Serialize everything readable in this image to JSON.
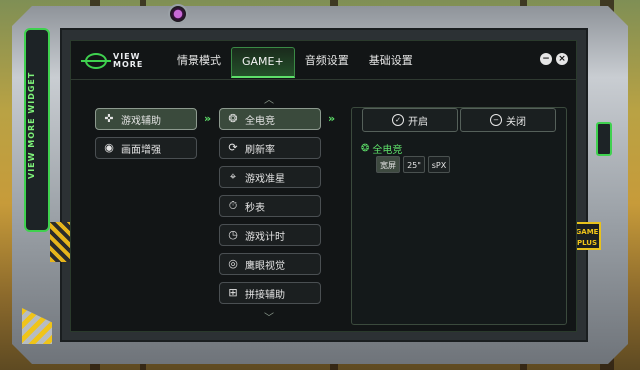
{
  "app": {
    "logo_line1": "VIEW",
    "logo_line2": "MORE",
    "side_label": "VIEW MORE WIDGET",
    "badge_line1": "GAME",
    "badge_line2": "PLUS"
  },
  "nav": {
    "tabs": [
      {
        "label": "情景模式",
        "active": false
      },
      {
        "label": "GAME+",
        "active": true
      },
      {
        "label": "音频设置",
        "active": false
      },
      {
        "label": "基础设置",
        "active": false
      }
    ],
    "minimize_label": "−",
    "close_label": "×"
  },
  "left_menu": [
    {
      "label": "游戏辅助",
      "icon": "gamepad-icon",
      "selected": true
    },
    {
      "label": "画面增强",
      "icon": "camera-lens-icon",
      "selected": false
    }
  ],
  "middle_menu": [
    {
      "label": "全电竞",
      "icon": "esports-icon",
      "selected": true
    },
    {
      "label": "刷新率",
      "icon": "refresh-icon",
      "selected": false
    },
    {
      "label": "游戏准星",
      "icon": "crosshair-icon",
      "selected": false
    },
    {
      "label": "秒表",
      "icon": "stopwatch-icon",
      "selected": false
    },
    {
      "label": "游戏计时",
      "icon": "timer-icon",
      "selected": false
    },
    {
      "label": "鹰眼视觉",
      "icon": "eagle-eye-icon",
      "selected": false
    },
    {
      "label": "拼接辅助",
      "icon": "splice-icon",
      "selected": false
    }
  ],
  "right_panel": {
    "tab_on": "开启",
    "tab_off": "关闭",
    "section_title": "全电竞",
    "options": [
      {
        "label": "宽屏",
        "active": true
      },
      {
        "label": "25\"",
        "active": false
      },
      {
        "label": "sPX",
        "active": false
      }
    ]
  },
  "colors": {
    "accent": "#5ee06a",
    "panel_bg": "#121516",
    "frame": "#b8bcc1",
    "hazard": "#f0c419"
  }
}
